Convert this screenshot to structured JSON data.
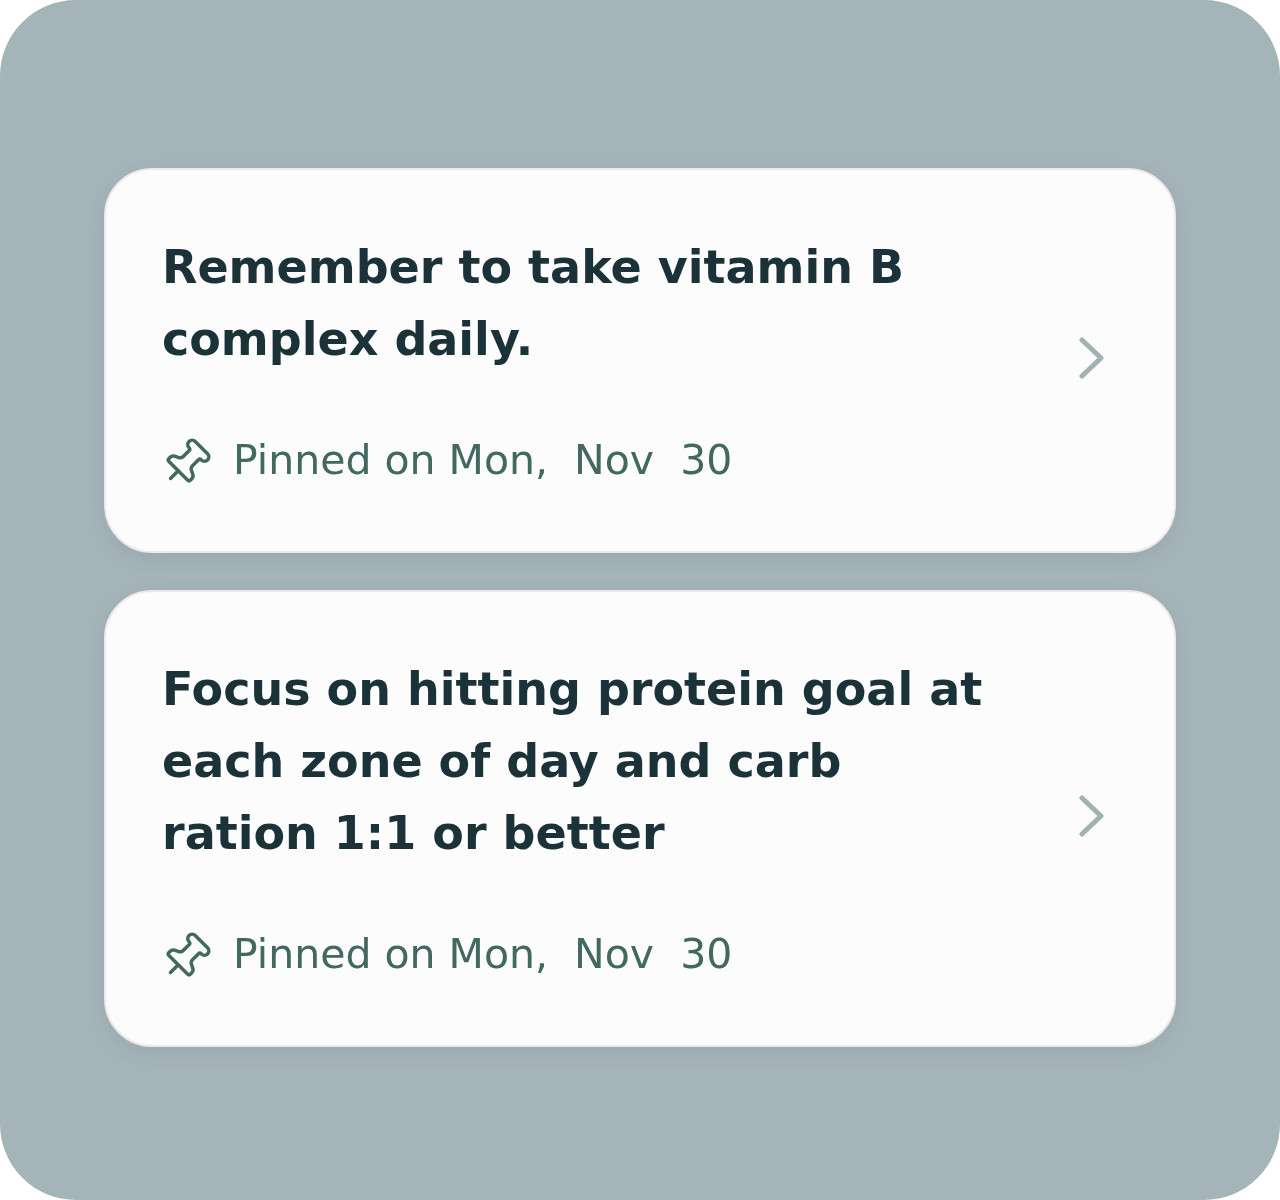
{
  "notes": [
    {
      "text": "Remember to take vitamin B complex daily.",
      "pinned_label": "Pinned on Mon,  Nov  30"
    },
    {
      "text": "Focus on hitting protein goal at each zone of day and carb ration 1:1 or better",
      "pinned_label": "Pinned on Mon,  Nov  30"
    }
  ]
}
